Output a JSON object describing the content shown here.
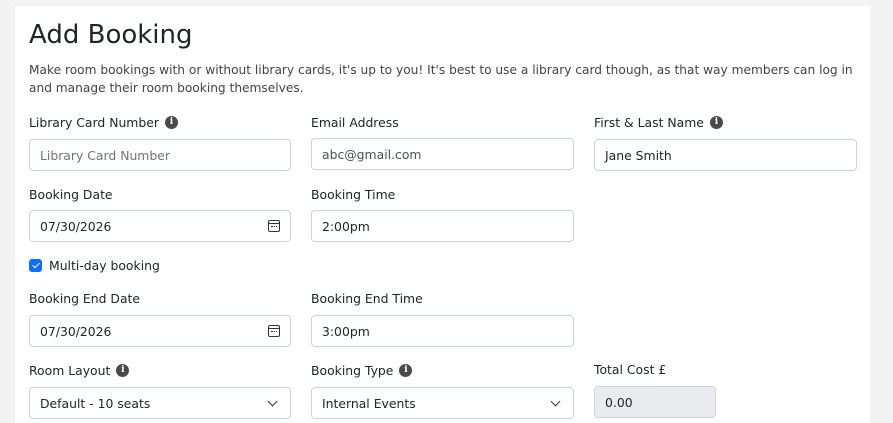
{
  "page": {
    "title": "Add Booking",
    "description": "Make room bookings with or without library cards, it's up to you! It's best to use a library card though, as that way members can log in and manage their room booking themselves."
  },
  "form": {
    "library_card": {
      "label": "Library Card Number",
      "placeholder": "Library Card Number",
      "value": ""
    },
    "email": {
      "label": "Email Address",
      "value": "abc@gmail.com"
    },
    "name": {
      "label": "First & Last Name",
      "value": "Jane Smith"
    },
    "booking_date": {
      "label": "Booking Date",
      "value": "07/30/2026"
    },
    "booking_time": {
      "label": "Booking Time",
      "value": "2:00pm"
    },
    "multi_day": {
      "label": "Multi-day booking",
      "checked": true
    },
    "end_date": {
      "label": "Booking End Date",
      "value": "07/30/2026"
    },
    "end_time": {
      "label": "Booking End Time",
      "value": "3:00pm"
    },
    "room_layout": {
      "label": "Room Layout",
      "selected": "Default - 10 seats"
    },
    "booking_type": {
      "label": "Booking Type",
      "selected": "Internal Events"
    },
    "total_cost": {
      "label": "Total Cost £",
      "value": "0.00"
    }
  },
  "icons": {
    "info": "info-icon",
    "calendar": "calendar-icon",
    "dropdown": "chevron-down-icon",
    "checkbox": "checkbox-checked"
  },
  "colors": {
    "accent": "#0d6efd",
    "readonly_bg": "#e9ecef",
    "border": "#ced4da"
  }
}
